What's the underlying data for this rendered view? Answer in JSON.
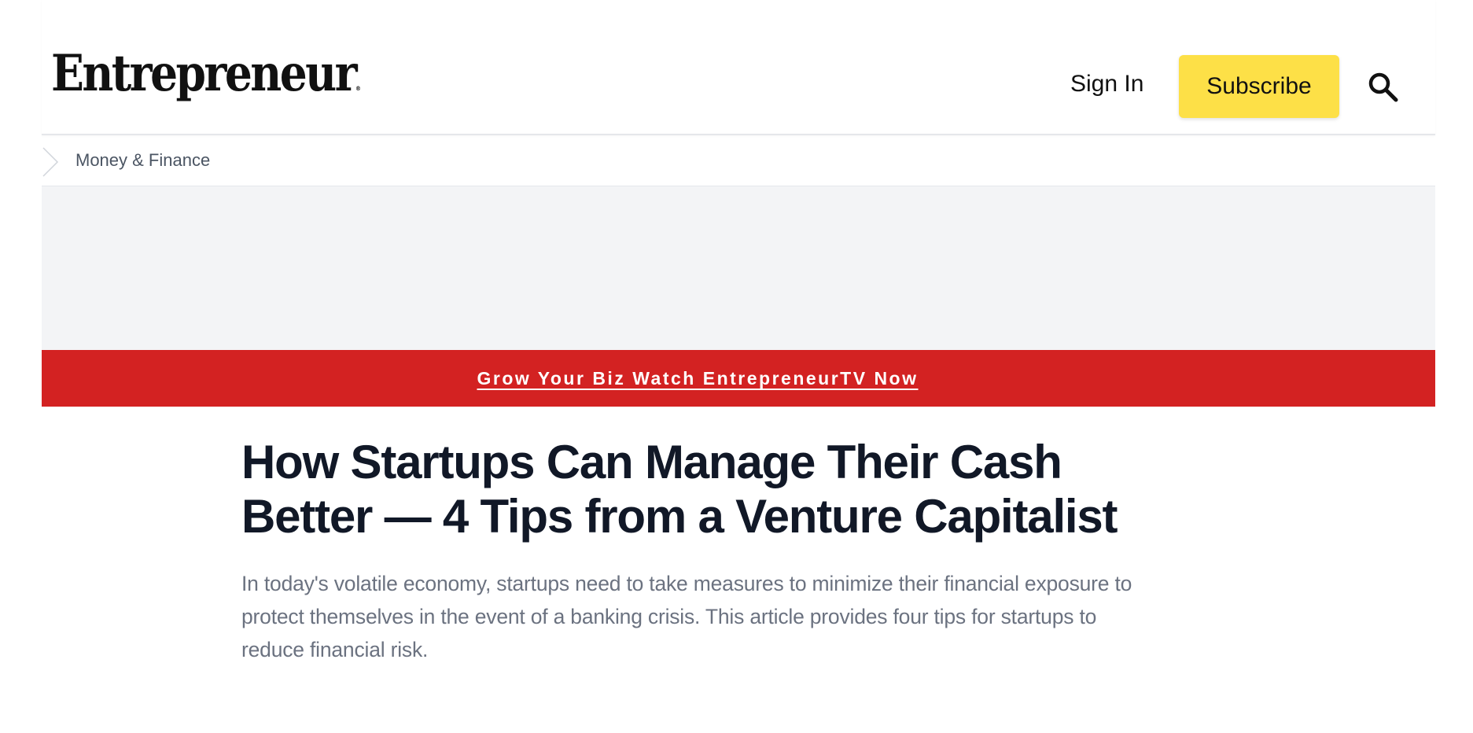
{
  "header": {
    "logo_text": "Entrepreneur",
    "logo_mark": "®",
    "signin_label": "Sign In",
    "subscribe_label": "Subscribe",
    "search_icon": "search-icon"
  },
  "breadcrumb": {
    "icon": "chevron-right-icon",
    "label": "Money & Finance"
  },
  "promo": {
    "text": "Grow Your Biz Watch EntrepreneurTV Now"
  },
  "article": {
    "title": "How Startups Can Manage Their Cash Better — 4 Tips from a Venture Capitalist",
    "dek": "In today's volatile economy, startups need to take measures to minimize their financial exposure to protect themselves in the event of a banking crisis. This article provides four tips for startups to reduce financial risk."
  },
  "colors": {
    "subscribe_bg": "#fde047",
    "promo_bg": "#d32222",
    "ad_bg": "#f3f4f6",
    "title": "#111827",
    "dek": "#6b7280"
  }
}
